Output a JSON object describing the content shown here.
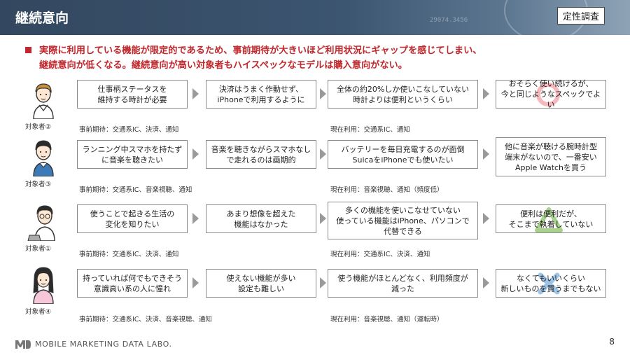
{
  "header": {
    "title": "継続意向",
    "tag": "定性調査",
    "deco_number": "29074.3456"
  },
  "lead": {
    "line1": "実際に利用している機能が限定的であるため、事前期待が大きいほど利用状況にギャップを感じてしまい、",
    "line2": "継続意向が低くなる。継続意向が高い対象者もハイスペックなモデルは購入意向がない。"
  },
  "rows": [
    {
      "person": "対象者②",
      "steps": [
        {
          "line1": "仕事柄ステータスを",
          "line2": "維持する時計が必要"
        },
        {
          "line1": "決済はうまく作動せず、",
          "line2": "iPhoneで利用するように"
        },
        {
          "line1": "全体の約20%しか使いこなしていない",
          "line2": "時計よりは便利というくらい"
        },
        {
          "line1": "おそらく使い続けるが、",
          "line2": "今と同じようなスペックでよい"
        }
      ],
      "expectation": "事前期待：交通系IC、決済、通知",
      "current": "現在利用：交通系IC、通知",
      "mark": "circle"
    },
    {
      "person": "対象者③",
      "steps": [
        {
          "line1": "ランニング中スマホを持たず",
          "line2": "に音楽を聴きたい"
        },
        {
          "line1": "音楽を聴きながらスマホなし",
          "line2": "で走れるのは画期的"
        },
        {
          "line1": "バッテリーを毎日充電するのが面倒",
          "line2": "SuicaをiPhoneでも使いたい"
        },
        {
          "line1": "他に音楽が聴ける腕時計型",
          "line2": "端末がないので、一番安い",
          "line3": "Apple Watchを買う"
        }
      ],
      "expectation": "事前期待：交通系IC、音楽視聴、通知",
      "current": "現在利用：音楽視聴、通知（頻度低）",
      "mark": "none"
    },
    {
      "person": "対象者①",
      "steps": [
        {
          "line1": "使うことで起きる生活の",
          "line2": "変化を知りたい"
        },
        {
          "line1": "あまり想像を超えた",
          "line2": "機能はなかった"
        },
        {
          "line1": "多くの機能を使いこなせていない",
          "line2": "使っている機能はiPhone、パソコンで",
          "line3": "代替できる"
        },
        {
          "line1": "便利は便利だが、",
          "line2": "そこまで執着していない"
        }
      ],
      "expectation": "事前期待：交通系IC、決済、通知",
      "current": "現在利用：交通系IC、決済、通知",
      "mark": "triangle"
    },
    {
      "person": "対象者④",
      "steps": [
        {
          "line1": "持っていれば何でもできそう",
          "line2": "意識高い系の人に憧れ"
        },
        {
          "line1": "使えない機能が多い",
          "line2": "設定も難しい"
        },
        {
          "line1": "使う機能がほとんどなく、利用頻度が",
          "line2": "減った"
        },
        {
          "line1": "なくてもいいくらい",
          "line2": "新しいものを買うまでもない"
        }
      ],
      "expectation": "事前期待：交通系IC、決済、音楽視聴、通知",
      "current": "現在利用：音楽視聴、通知（運転時）",
      "mark": "cross"
    }
  ],
  "footer": {
    "logo_text": "MOBILE MARKETING DATA LABO.",
    "page": "8"
  },
  "colors": {
    "header": "#3c5570",
    "accent": "#c0282d",
    "circle_mark": "#f4b8bd",
    "triangle_mark": "#a9d18e",
    "cross_mark": "#9dc3e6",
    "arrow": "#9a9a9a"
  }
}
